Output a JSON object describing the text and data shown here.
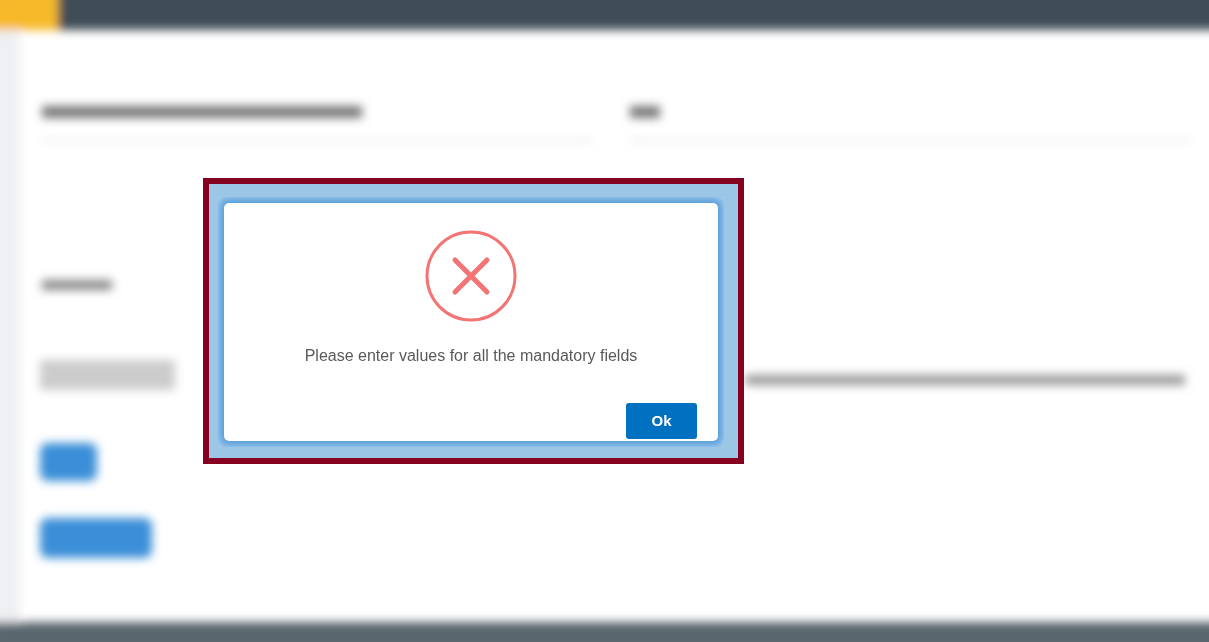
{
  "dialog": {
    "kind": "error",
    "message": "Please enter values for all the mandatory fields",
    "button": "Ok"
  }
}
